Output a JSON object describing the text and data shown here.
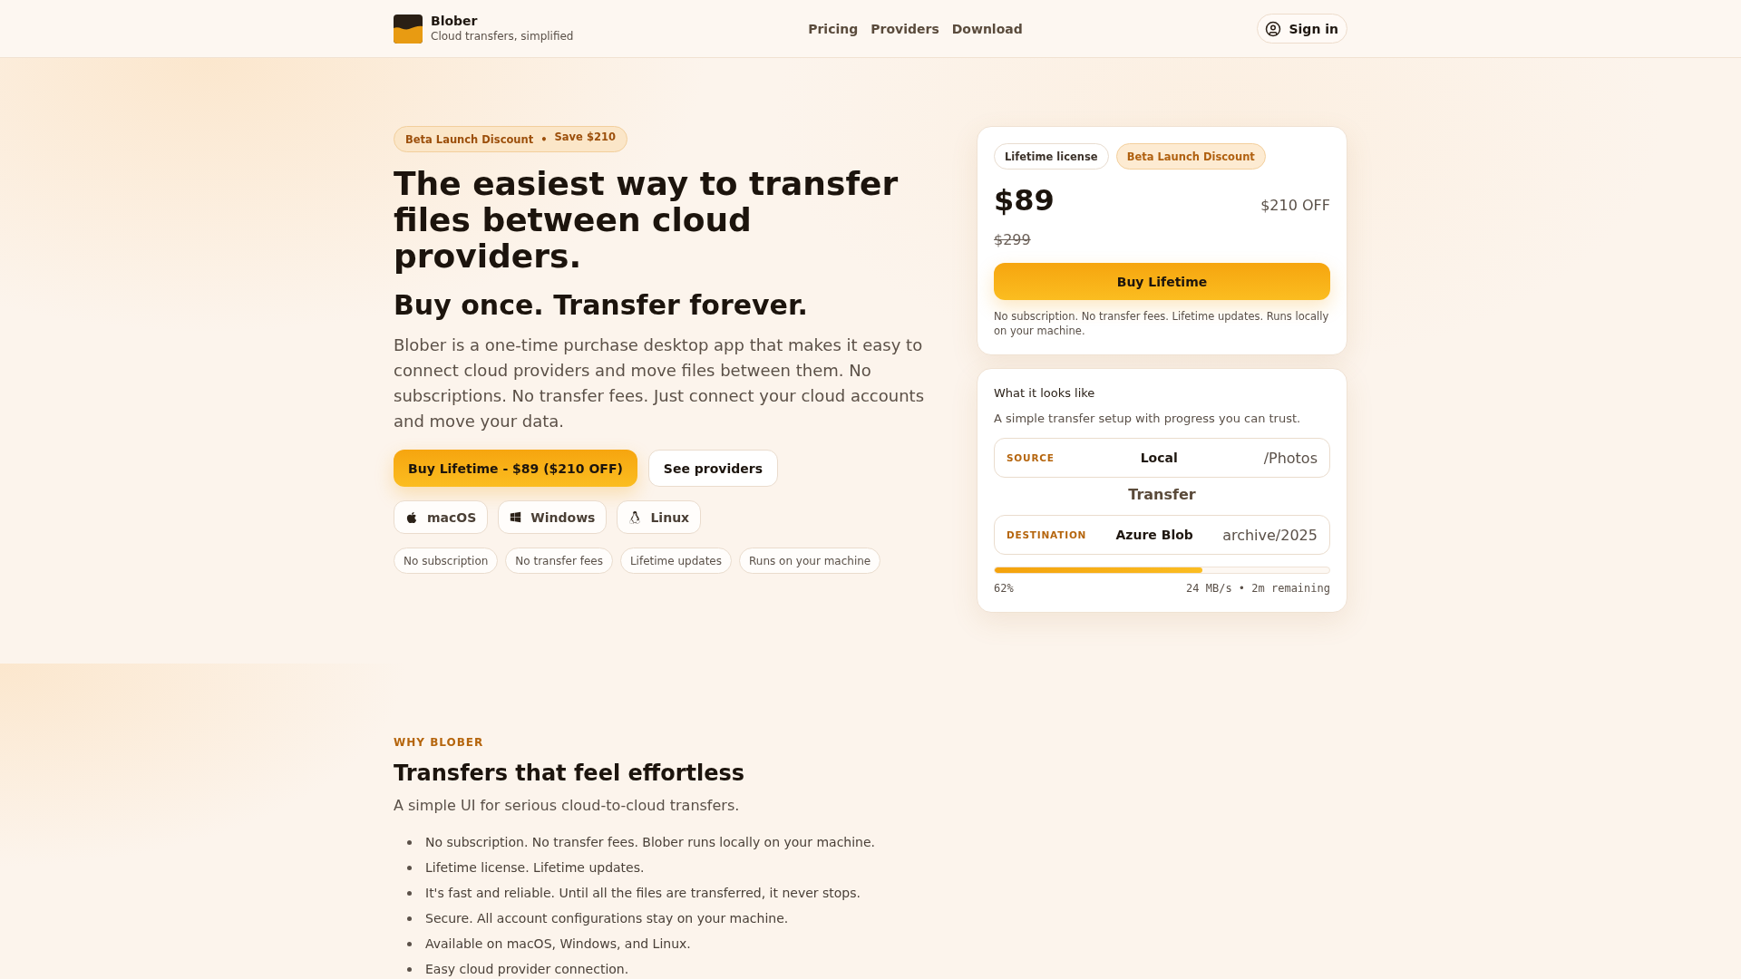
{
  "header": {
    "brand": "Blober",
    "tagline": "Cloud transfers, simplified",
    "nav": [
      "Pricing",
      "Providers",
      "Download"
    ],
    "sign_in": "Sign in"
  },
  "hero": {
    "badge": {
      "label": "Beta Launch Discount",
      "separator": "•",
      "note": "Save $210"
    },
    "headline": "The easiest way to transfer files between cloud providers.",
    "subheadline": "Buy once. Transfer forever.",
    "description": "Blober is a one-time purchase desktop app that makes it easy to connect cloud providers and move files between them. No subscriptions. No transfer fees. Just connect your cloud accounts and move your data.",
    "buttons": [
      {
        "label": "Buy Lifetime - $89 ($210 OFF)",
        "kind": "primary"
      },
      {
        "label": "See providers",
        "kind": "secondary"
      }
    ],
    "platforms": [
      {
        "label": "macOS",
        "kind": "apple"
      },
      {
        "label": "Windows",
        "kind": "windows"
      },
      {
        "label": "Linux",
        "kind": "penguin"
      }
    ],
    "features": [
      "No subscription",
      "No transfer fees",
      "Lifetime updates",
      "Runs on your machine"
    ]
  },
  "pricing_card": {
    "tags": [
      {
        "label": "Lifetime license",
        "kind": "neutral"
      },
      {
        "label": "Beta Launch Discount",
        "kind": "accent"
      }
    ],
    "price": "$89",
    "discount": "$210 OFF",
    "original_price": "$299",
    "button": "Buy Lifetime",
    "fine_print": "No subscription. No transfer fees. Lifetime updates. Runs locally on your machine."
  },
  "preview_card": {
    "title": "What it looks like",
    "subtitle": "A simple transfer setup with progress you can trust.",
    "source": {
      "label": "SOURCE",
      "provider": "Local",
      "path": "/Photos"
    },
    "transfer_label": "Transfer",
    "destination": {
      "label": "DESTINATION",
      "provider": "Azure Blob",
      "path": "archive/2025"
    },
    "progress": {
      "level": 0.62,
      "percent": "62%",
      "status": "24 MB/s • 2m remaining"
    }
  },
  "why": {
    "eyebrow": "WHY BLOBER",
    "title": "Transfers that feel effortless",
    "subtitle": "A simple UI for serious cloud-to-cloud transfers.",
    "points": [
      "No subscription. No transfer fees. Blober runs locally on your machine.",
      "Lifetime license. Lifetime updates.",
      "It's fast and reliable. Until all the files are transferred, it never stops.",
      "Secure. All account configurations stay on your machine.",
      "Available on macOS, Windows, and Linux.",
      "Easy cloud provider connection."
    ]
  }
}
